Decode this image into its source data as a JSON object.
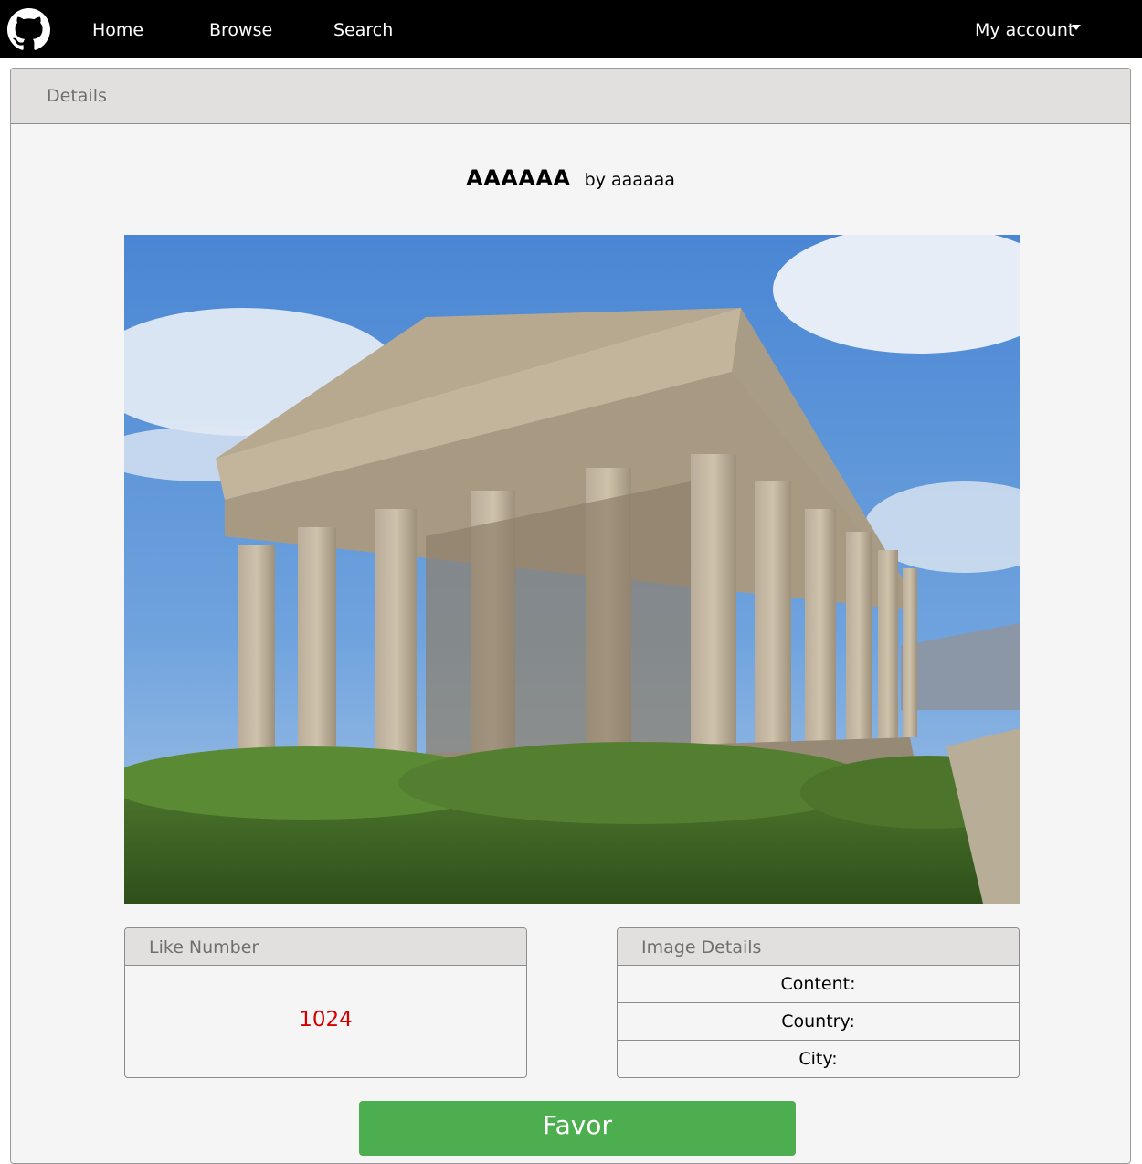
{
  "nav": {
    "logo_icon": "github-icon",
    "home": "Home",
    "browse": "Browse",
    "search": "Search",
    "account": "My account",
    "account_icon": "caret-down-icon"
  },
  "card": {
    "header": "Details"
  },
  "image": {
    "title": "AAAAAA",
    "author": "by aaaaaa"
  },
  "like_panel": {
    "header": "Like Number",
    "value": "1024"
  },
  "details_panel": {
    "header": "Image Details",
    "rows": [
      "Content:",
      "Country:",
      "City:"
    ]
  },
  "favor_button": "Favor",
  "colors": {
    "navbar": "#000000",
    "header_bg": "#e1e0df",
    "like_value": "#d40000",
    "favor_bg": "#4cae4f"
  }
}
